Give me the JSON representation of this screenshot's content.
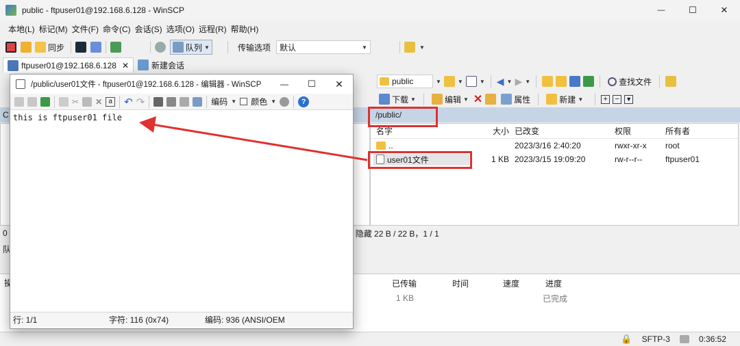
{
  "main_window": {
    "title": "public - ftpuser01@192.168.6.128 - WinSCP",
    "controls": {
      "minimize": "—",
      "maximize": "☐",
      "close": "✕"
    }
  },
  "menu": {
    "items": [
      "本地(L)",
      "标记(M)",
      "文件(F)",
      "命令(C)",
      "会话(S)",
      "选项(O)",
      "远程(R)",
      "帮助(H)"
    ]
  },
  "toolbar": {
    "sync_label": "同步",
    "queue_label": "队列",
    "transfer_label": "传输选项",
    "transfer_value": "默认"
  },
  "tabs": [
    {
      "label": "ftpuser01@192.168.6.128",
      "close": "✕"
    },
    {
      "label": "新建会话"
    }
  ],
  "remote_toolbar": {
    "folder": "public",
    "find_files": "查找文件",
    "download": "下载",
    "edit": "编辑",
    "properties": "属性",
    "new": "新建"
  },
  "remote_path": "/public/",
  "left_path_initial": "C",
  "file_columns": {
    "name": "名字",
    "size": "大小",
    "modified": "已改变",
    "rights": "权限",
    "owner": "所有者"
  },
  "files": [
    {
      "name": "..",
      "size": "",
      "modified": "2023/3/16 2:40:20",
      "rights": "rwxr-xr-x",
      "owner": "root"
    },
    {
      "name": "user01文件",
      "size": "1 KB",
      "modified": "2023/3/15 19:09:20",
      "rights": "rw-r--r--",
      "owner": "ftpuser01"
    }
  ],
  "status_mid": {
    "left_zero": "0",
    "right_info": "隐藏  22 B / 22 B，1 / 1"
  },
  "queue": {
    "left_label": "队",
    "col_left": "操",
    "columns": {
      "transferred": "已传输",
      "time": "时间",
      "speed": "速度",
      "progress": "进度"
    },
    "rows": [
      {
        "transferred": "1 KB",
        "progress": "已完成"
      }
    ]
  },
  "statusbar": {
    "protocol": "SFTP-3",
    "time": "0:36:52"
  },
  "editor": {
    "title": "/public/user01文件 - ftpuser01@192.168.6.128 - 编辑器 - WinSCP",
    "encoding_btn": "编码",
    "color_btn": "颜色",
    "content": "this is ftpuser01 file",
    "status_line": "行: 1/1",
    "status_char": "字符: 116 (0x74)",
    "status_encoding": "编码: 936  (ANSI/OEM"
  },
  "colors": {
    "highlight_box": "#e03030",
    "arrow": "#e03030",
    "path_bar": "#c6d5e6"
  }
}
